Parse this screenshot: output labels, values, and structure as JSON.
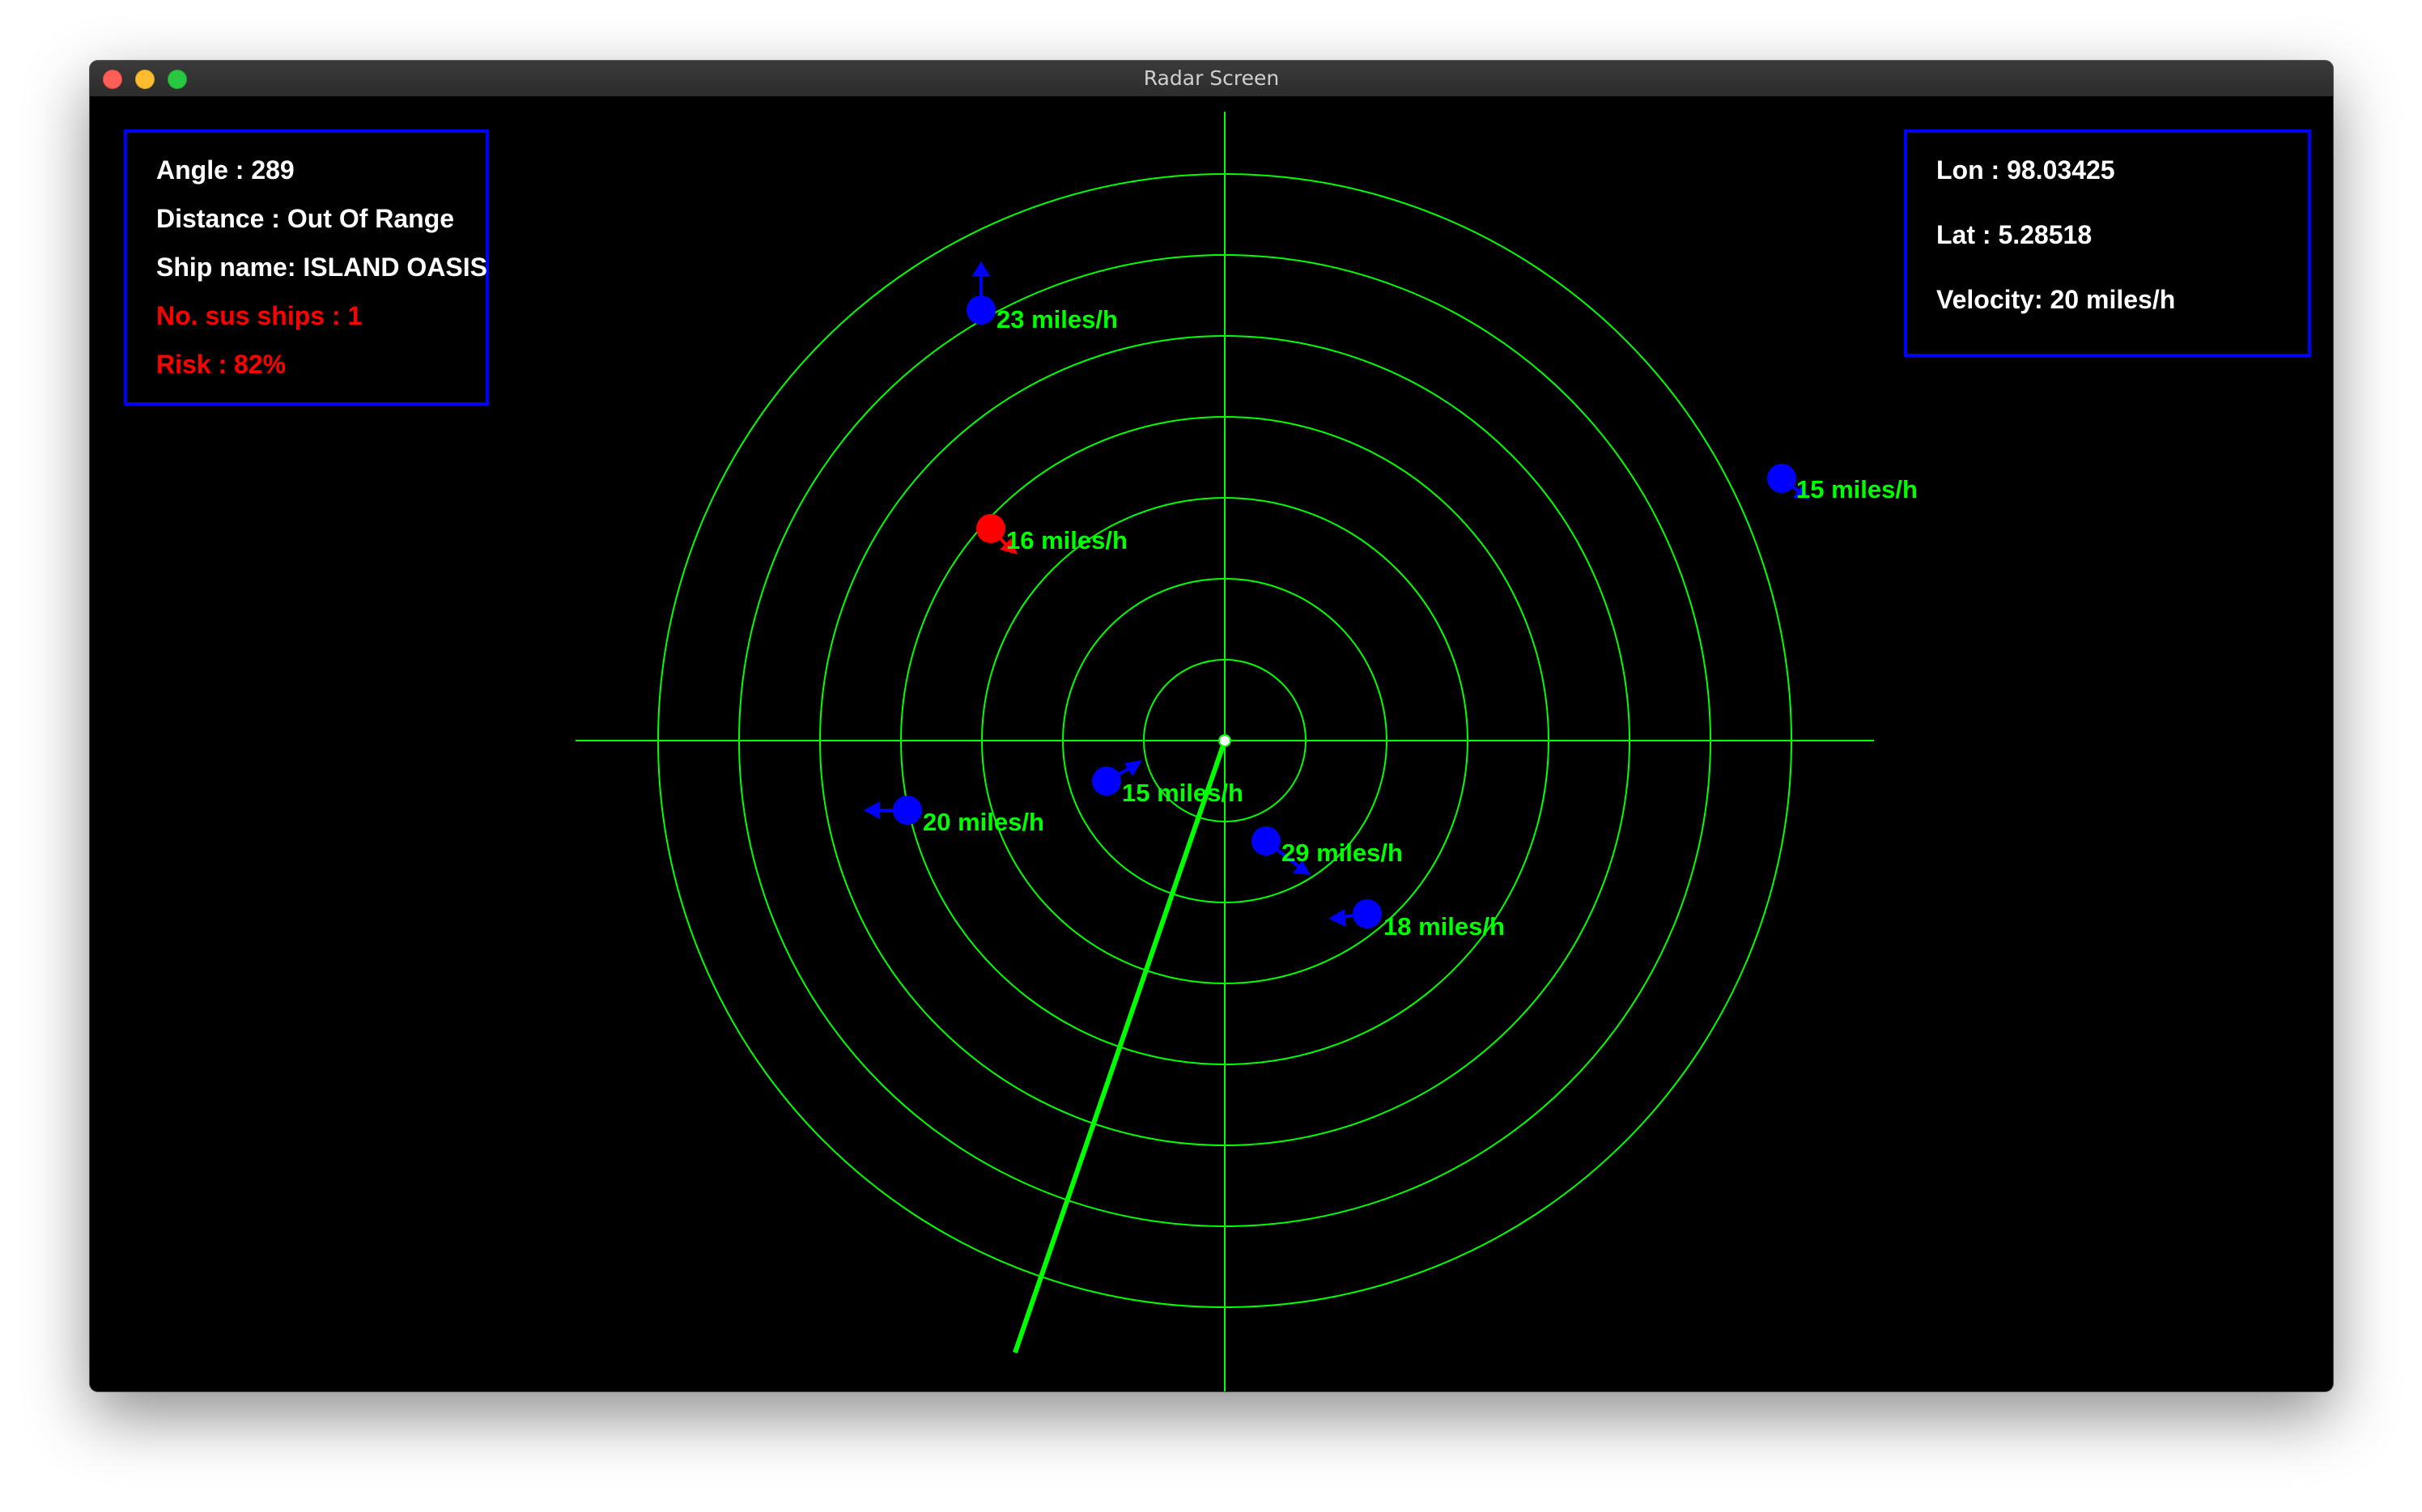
{
  "window": {
    "title": "Radar Screen"
  },
  "left_panel": {
    "angle": "Angle : 289",
    "distance": "Distance : Out Of Range",
    "ship_name": "Ship name: ISLAND OASIS",
    "sus_ships": "No. sus ships : 1",
    "risk": "Risk : 82%"
  },
  "right_panel": {
    "lon": "Lon : 98.03425",
    "lat": "Lat : 5.28518",
    "velocity": "Velocity: 20 miles/h"
  },
  "radar": {
    "ring_count": 7,
    "sweep_angle_deg": 289,
    "grid_color": "#00ff00",
    "sweep_color": "#00ff00",
    "ship_color": "#0000ff",
    "suspicious_color": "#ff0000"
  },
  "ships": [
    {
      "id": "ship-1",
      "label": "23 miles/h",
      "heading": "up",
      "suspicious": false
    },
    {
      "id": "ship-2",
      "label": "15 miles/h",
      "heading": "down-right",
      "suspicious": false
    },
    {
      "id": "ship-3",
      "label": "16 miles/h",
      "heading": "down-right",
      "suspicious": true
    },
    {
      "id": "ship-4",
      "label": "20 miles/h",
      "heading": "left",
      "suspicious": false
    },
    {
      "id": "ship-5",
      "label": "15 miles/h",
      "heading": "up-right",
      "suspicious": false
    },
    {
      "id": "ship-6",
      "label": "29 miles/h",
      "heading": "down-right",
      "suspicious": false
    },
    {
      "id": "ship-7",
      "label": "18 miles/h",
      "heading": "left",
      "suspicious": false
    }
  ]
}
